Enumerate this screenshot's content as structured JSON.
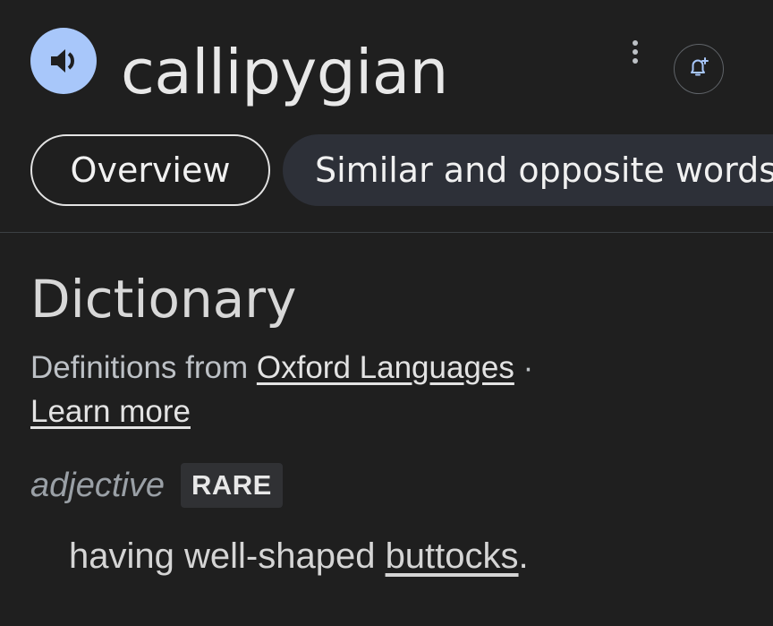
{
  "header": {
    "word": "callipygian",
    "speaker_icon": "speaker-icon",
    "more_icon": "more-vert-icon",
    "alert_icon": "bell-plus-icon"
  },
  "tabs": [
    {
      "label": "Overview",
      "selected": true
    },
    {
      "label": "Similar and opposite words",
      "selected": false
    }
  ],
  "dictionary": {
    "heading": "Dictionary",
    "source_prefix": "Definitions from ",
    "source_link": "Oxford Languages",
    "source_suffix": " ·",
    "learn_more": "Learn more",
    "part_of_speech": "adjective",
    "badge": "RARE",
    "definition_prefix": "having well-shaped ",
    "definition_link": "buttocks",
    "definition_suffix": "."
  },
  "colors": {
    "background": "#1f1f1f",
    "speaker_accent": "#a8c7fa",
    "tab_inactive_bg": "#2d3038",
    "badge_bg": "#303134"
  }
}
